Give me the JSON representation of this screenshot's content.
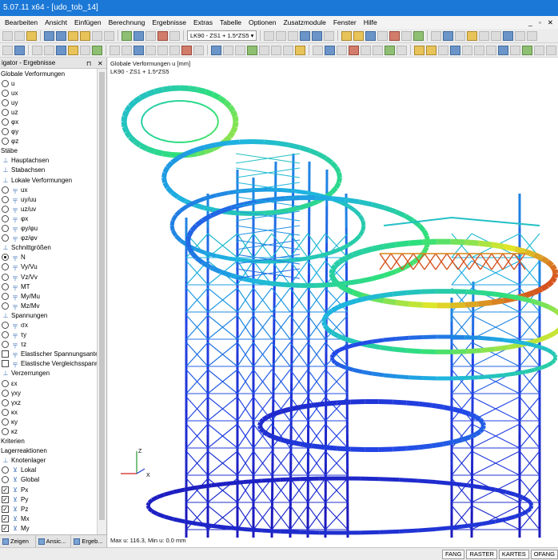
{
  "window": {
    "title": "5.07.11 x64 - [udo_tob_14]"
  },
  "menu": {
    "items": [
      "Bearbeiten",
      "Ansicht",
      "Einfügen",
      "Berechnung",
      "Ergebnisse",
      "Extras",
      "Tabelle",
      "Optionen",
      "Zusatzmodule",
      "Fenster",
      "Hilfe"
    ]
  },
  "toolbar": {
    "loadcase_combo": "LK90 - ZS1 + 1.5*ZS5"
  },
  "navigator": {
    "title": "igator - Ergebnisse",
    "items": [
      {
        "type": "section",
        "label": "Globale Verformungen"
      },
      {
        "type": "radio",
        "label": "u",
        "icon": "none"
      },
      {
        "type": "radio",
        "label": "ux",
        "icon": "none"
      },
      {
        "type": "radio",
        "label": "uy",
        "icon": "none"
      },
      {
        "type": "radio",
        "label": "uz",
        "icon": "none"
      },
      {
        "type": "radio",
        "label": "φx",
        "icon": "none"
      },
      {
        "type": "radio",
        "label": "φy",
        "icon": "none"
      },
      {
        "type": "radio",
        "label": "φz",
        "icon": "none"
      },
      {
        "type": "section",
        "label": "Stäbe"
      },
      {
        "type": "folder",
        "label": "Hauptachsen"
      },
      {
        "type": "folder",
        "label": "Stabachsen"
      },
      {
        "type": "folder",
        "label": "Lokale Verformungen"
      },
      {
        "type": "radio",
        "label": "ux",
        "icon": "member"
      },
      {
        "type": "radio",
        "label": "uy/uu",
        "icon": "member"
      },
      {
        "type": "radio",
        "label": "uz/uv",
        "icon": "member"
      },
      {
        "type": "radio",
        "label": "φx",
        "icon": "member"
      },
      {
        "type": "radio",
        "label": "φy/φu",
        "icon": "member"
      },
      {
        "type": "radio",
        "label": "φz/φv",
        "icon": "member"
      },
      {
        "type": "folder",
        "label": "Schnittgrößen"
      },
      {
        "type": "radio",
        "label": "N",
        "icon": "member",
        "checked": true
      },
      {
        "type": "radio",
        "label": "Vy/Vu",
        "icon": "member"
      },
      {
        "type": "radio",
        "label": "Vz/Vv",
        "icon": "member"
      },
      {
        "type": "radio",
        "label": "MT",
        "icon": "member"
      },
      {
        "type": "radio",
        "label": "My/Mu",
        "icon": "member"
      },
      {
        "type": "radio",
        "label": "Mz/Mv",
        "icon": "member"
      },
      {
        "type": "folder",
        "label": "Spannungen"
      },
      {
        "type": "radio",
        "label": "σx",
        "icon": "member"
      },
      {
        "type": "radio",
        "label": "τy",
        "icon": "member"
      },
      {
        "type": "radio",
        "label": "τz",
        "icon": "member"
      },
      {
        "type": "check",
        "label": "Elastischer Spannungsante",
        "icon": "member"
      },
      {
        "type": "check",
        "label": "Elastische Vergleichsspann",
        "icon": "member"
      },
      {
        "type": "folder",
        "label": "Verzerrungen"
      },
      {
        "type": "radio",
        "label": "εx",
        "icon": "none"
      },
      {
        "type": "radio",
        "label": "γxy",
        "icon": "none"
      },
      {
        "type": "radio",
        "label": "γxz",
        "icon": "none"
      },
      {
        "type": "radio",
        "label": "κx",
        "icon": "none"
      },
      {
        "type": "radio",
        "label": "κy",
        "icon": "none"
      },
      {
        "type": "radio",
        "label": "κz",
        "icon": "none"
      },
      {
        "type": "section",
        "label": "Kriterien"
      },
      {
        "type": "section",
        "label": "Lagerreaktionen"
      },
      {
        "type": "folder",
        "label": "Knotenlager"
      },
      {
        "type": "radio",
        "label": "Lokal",
        "icon": "support"
      },
      {
        "type": "radio",
        "label": "Global",
        "icon": "support"
      },
      {
        "type": "check",
        "label": "Px",
        "icon": "support",
        "checked": true
      },
      {
        "type": "check",
        "label": "Py",
        "icon": "support",
        "checked": true
      },
      {
        "type": "check",
        "label": "Pz",
        "icon": "support",
        "checked": true
      },
      {
        "type": "check",
        "label": "Mx",
        "icon": "support",
        "checked": true
      },
      {
        "type": "check",
        "label": "My",
        "icon": "support",
        "checked": true
      }
    ],
    "tabs": [
      "Zeigen",
      "Ansic...",
      "Ergeb..."
    ]
  },
  "viewport": {
    "title": "Globale Verformungen u [mm]",
    "subtitle": "LK90 - ZS1 + 1.5*ZS5",
    "max_text": "Max u: 116.3, Min u: 0.0 mm",
    "axis_labels": {
      "z": "Z",
      "x": "X"
    },
    "colors": {
      "low": "#1a0fb3",
      "mid": "#2fe07a",
      "high": "#d11a1a"
    }
  },
  "statusbar": {
    "buttons": [
      "FANG",
      "RASTER",
      "KARTES",
      "OFANG"
    ]
  }
}
